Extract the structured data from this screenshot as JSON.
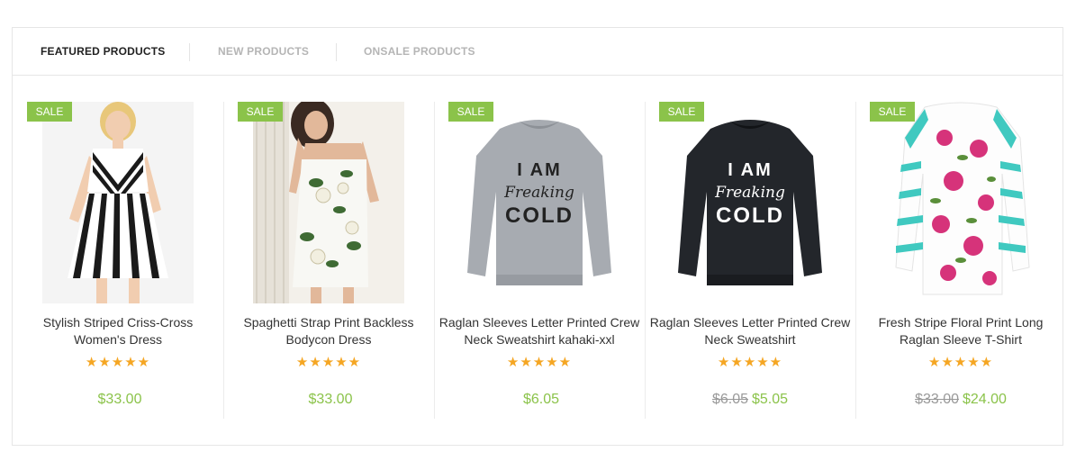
{
  "tabs": [
    {
      "label": "FEATURED PRODUCTS"
    },
    {
      "label": "NEW PRODUCTS"
    },
    {
      "label": "ONSALE PRODUCTS"
    }
  ],
  "colors": {
    "sale_badge": "#8bc34a",
    "price": "#8bc34a",
    "star": "#f5a623"
  },
  "products": [
    {
      "badge": "SALE",
      "name_line1": "Stylish Striped Criss-Cross",
      "name_line2": "Women's Dress",
      "stars": "★★★★★",
      "old_price": "",
      "price": "$33.00",
      "rating": 5
    },
    {
      "badge": "SALE",
      "name_line1": "Spaghetti Strap Print Backless",
      "name_line2": "Bodycon Dress",
      "stars": "★★★★★",
      "old_price": "",
      "price": "$33.00",
      "rating": 5
    },
    {
      "badge": "SALE",
      "name_line1": "Raglan Sleeves Letter Printed Crew",
      "name_line2": "Neck Sweatshirt kahaki-xxl",
      "stars": "★★★★★",
      "old_price": "",
      "price": "$6.05",
      "rating": 5,
      "print": [
        "I AM",
        "Freaking",
        "COLD"
      ]
    },
    {
      "badge": "SALE",
      "name_line1": "Raglan Sleeves Letter Printed Crew",
      "name_line2": "Neck Sweatshirt",
      "stars": "★★★★★",
      "old_price": "$6.05",
      "price": "$5.05",
      "rating": 5,
      "print": [
        "I AM",
        "Freaking",
        "COLD"
      ]
    },
    {
      "badge": "SALE",
      "name_line1": "Fresh Stripe Floral Print Long",
      "name_line2": "Raglan Sleeve T-Shirt",
      "stars": "★★★★★",
      "old_price": "$33.00",
      "price": "$24.00",
      "rating": 5
    }
  ]
}
